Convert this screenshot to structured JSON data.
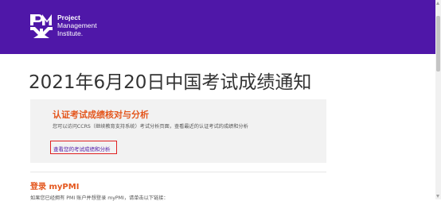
{
  "header": {
    "logo_lines": [
      "Project",
      "Management",
      "Institute."
    ],
    "background_color": "#4f17a8"
  },
  "page": {
    "title": "2021年6月20日中国考试成绩通知"
  },
  "card": {
    "title": "认证考试成绩核对与分析",
    "description": "您可以访问CCRS（继续教育支持系统）考试分析页面，查看最近的认证考试的成绩和分析",
    "link_label": "查看您的考试成绩和分析",
    "accent_color": "#e4571e"
  },
  "section": {
    "title": "登录 myPMI",
    "text": "如果您已经拥有 PMI 账户并想登录 myPMI，请单击以下链接："
  }
}
